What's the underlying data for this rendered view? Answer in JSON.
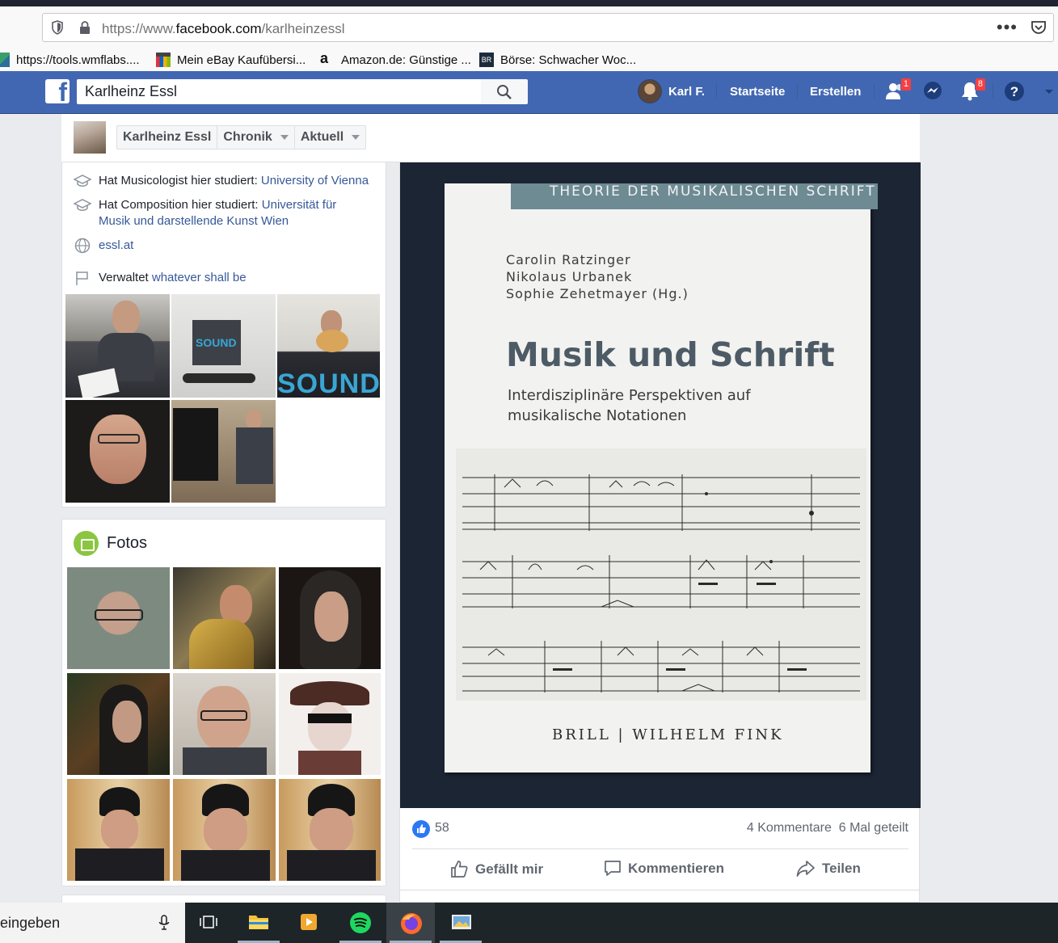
{
  "browser": {
    "url_prefix": "https://www.",
    "url_domain": "facebook.com",
    "url_path": "/karlheinzessl",
    "menu_dots": "•••",
    "bookmarks": [
      {
        "label": "https://tools.wmflabs...."
      },
      {
        "label": "Mein eBay Kaufübersi..."
      },
      {
        "label": "Amazon.de: Günstige ..."
      },
      {
        "label": "Börse: Schwacher Woc..."
      }
    ]
  },
  "facebook": {
    "logo": "f",
    "search_value": "Karlheinz Essl",
    "nav": {
      "user": "Karl F.",
      "home": "Startseite",
      "create": "Erstellen",
      "friend_requests_badge": "1",
      "notifications_badge": "8"
    }
  },
  "page_header": {
    "tabs": [
      {
        "label": "Karlheinz Essl"
      },
      {
        "label": "Chronik"
      },
      {
        "label": "Aktuell"
      }
    ]
  },
  "intro": {
    "items": [
      {
        "prefix": "Hat Musicologist hier studiert: ",
        "link": "University of Vienna"
      },
      {
        "prefix": "Hat Composition hier studiert: ",
        "link": "Universität für Musik und darstellende Kunst Wien"
      },
      {
        "prefix": "",
        "link": "essl.at"
      },
      {
        "prefix": "Verwaltet ",
        "link": "whatever shall be"
      }
    ],
    "sound_label_small": "SOUND",
    "sound_label_big": "SOUND"
  },
  "photos": {
    "title": "Fotos"
  },
  "post": {
    "book": {
      "series": "THEORIE DER MUSIKALISCHEN SCHRIFT",
      "authors": [
        "Carolin Ratzinger",
        "Nikolaus Urbanek",
        "Sophie Zehetmayer (Hg.)"
      ],
      "title": "Musik und Schrift",
      "subtitle_line1": "Interdisziplinäre Perspektiven auf",
      "subtitle_line2": "musikalische Notationen",
      "publisher": "BRILL | WILHELM FINK"
    },
    "likes": "58",
    "comments": "4 Kommentare",
    "shares": "6 Mal geteilt",
    "actions": {
      "like": "Gefällt mir",
      "comment": "Kommentieren",
      "share": "Teilen"
    }
  },
  "taskbar": {
    "search_text": "eingeben"
  },
  "colors": {
    "facebook_blue": "#4267b2",
    "link": "#365899",
    "like_blue": "#2b78f5",
    "badge_red": "#fa3e3e"
  }
}
